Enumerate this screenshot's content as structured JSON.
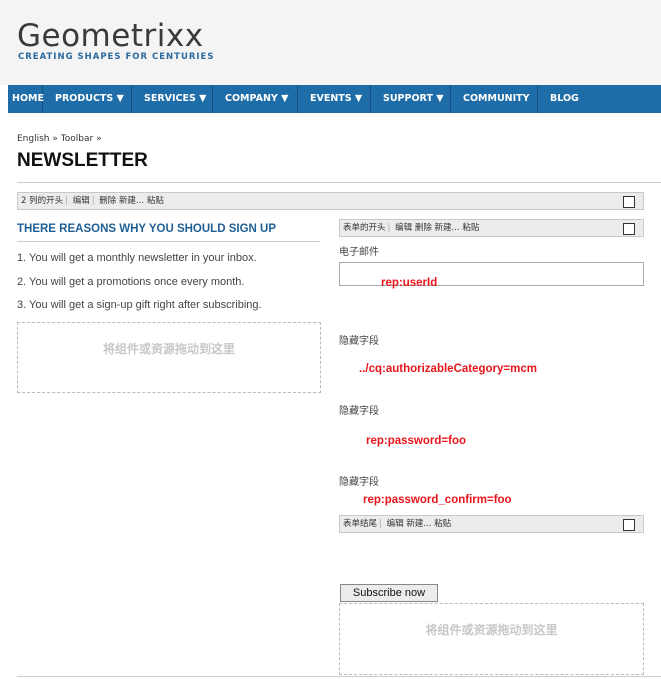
{
  "brand": {
    "logo": "Geometrixx",
    "tagline": "CREATING SHAPES FOR CENTURIES"
  },
  "nav": [
    {
      "label": "HOME"
    },
    {
      "label": "PRODUCTS ▼"
    },
    {
      "label": "SERVICES ▼"
    },
    {
      "label": "COMPANY ▼"
    },
    {
      "label": "EVENTS ▼"
    },
    {
      "label": "SUPPORT ▼"
    },
    {
      "label": "COMMUNITY"
    },
    {
      "label": "BLOG"
    }
  ],
  "breadcrumb": {
    "items": [
      "English",
      "Toolbar"
    ],
    "separator": "»"
  },
  "page_title": "NEWSLETTER",
  "column_bar": {
    "label": "2 列的开头",
    "edit": "编辑",
    "delete": "删除",
    "new": "新建...",
    "paste": "粘贴"
  },
  "left": {
    "heading": "THERE REASONS WHY YOU SHOULD SIGN UP",
    "reasons": [
      "1. You will get a monthly newsletter in your inbox.",
      "2. You will get a promotions once every month.",
      "3. You will get a sign-up gift right after subscribing."
    ],
    "drop_text": "将组件或资源拖动到这里"
  },
  "form_bar": {
    "label": "表单的开头",
    "edit": "编辑",
    "delete": "删除",
    "new": "新建...",
    "paste": "粘贴"
  },
  "form": {
    "email_label": "电子邮件",
    "email_value": "",
    "hidden_label": "隐藏字段",
    "annotations": [
      "rep:userId",
      "../cq:authorizableCategory=mcm",
      "rep:password=foo",
      "rep:password_confirm=foo"
    ]
  },
  "form_end_bar": {
    "label": "表单结尾",
    "edit": "编辑",
    "new": "新建...",
    "paste": "粘贴"
  },
  "subscribe_button": "Subscribe now",
  "right_drop_text": "将组件或资源拖动到这里",
  "colors": {
    "nav_bg": "#1f6da8",
    "annotation_red": "#e8151b",
    "heading_blue": "#1f5f96"
  }
}
